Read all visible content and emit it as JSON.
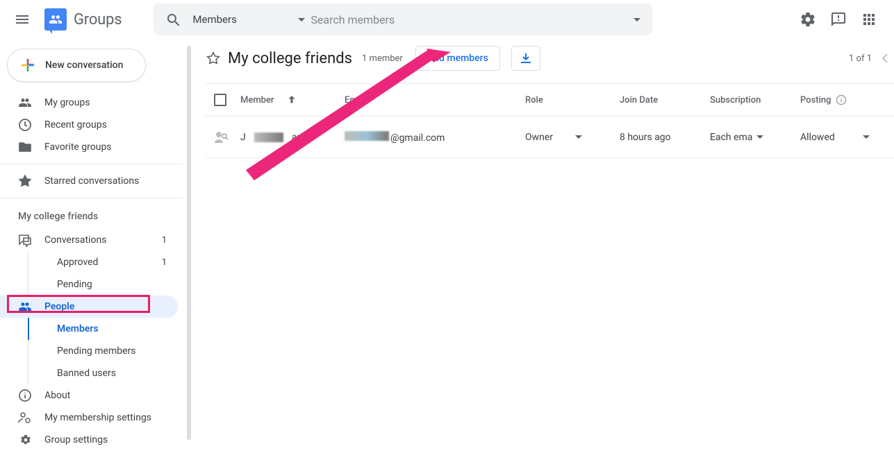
{
  "brand": "Groups",
  "search": {
    "chip_label": "Members",
    "placeholder": "Search members"
  },
  "new_conversation_label": "New conversation",
  "sidebar": {
    "top": [
      {
        "label": "My groups"
      },
      {
        "label": "Recent groups"
      },
      {
        "label": "Favorite groups"
      }
    ],
    "starred_label": "Starred conversations",
    "group_heading": "My college friends",
    "conv_label": "Conversations",
    "conv_count": "1",
    "approved_label": "Approved",
    "approved_count": "1",
    "pending_label": "Pending",
    "people_label": "People",
    "members_label": "Members",
    "pending_members_label": "Pending members",
    "banned_label": "Banned users",
    "about_label": "About",
    "membership_label": "My membership settings",
    "settings_label": "Group settings"
  },
  "main": {
    "title": "My college friends",
    "member_count": "1 member",
    "add_members_label": "Add members",
    "pager": "1 of 1"
  },
  "table": {
    "headers": {
      "member": "Member",
      "email": "Email",
      "role": "Role",
      "join": "Join Date",
      "sub": "Subscription",
      "post": "Posting"
    },
    "row": {
      "name_prefix": "J",
      "name_suffix": "an",
      "email_suffix": "@gmail.com",
      "role": "Owner",
      "join": "8 hours ago",
      "sub": "Each ema",
      "post": "Allowed"
    }
  }
}
